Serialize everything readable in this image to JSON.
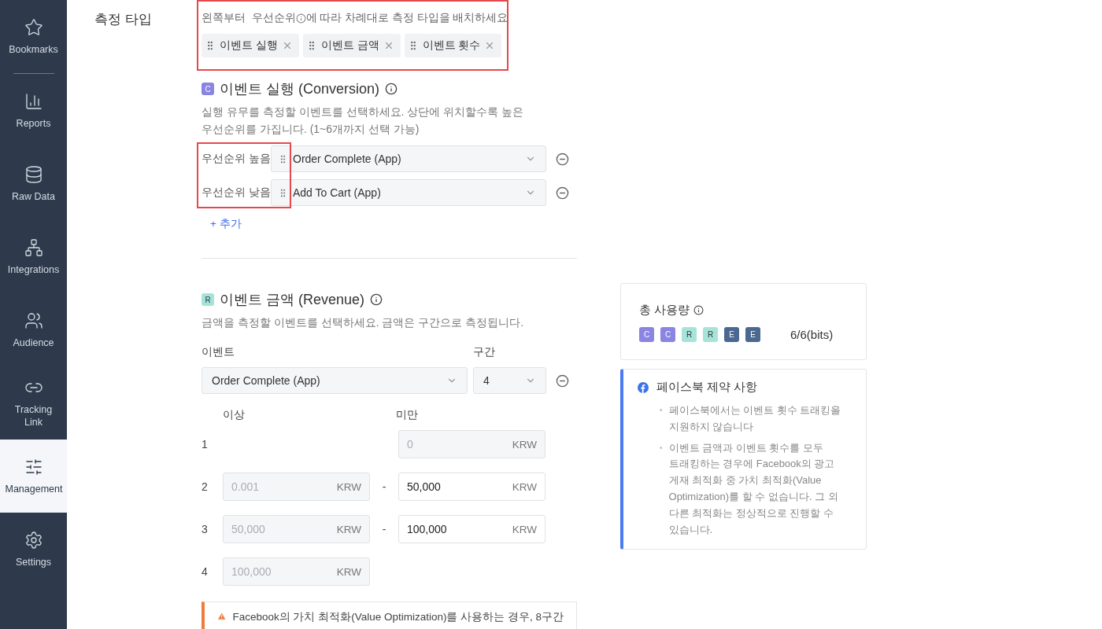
{
  "sidebar": {
    "items": [
      {
        "label": "Bookmarks",
        "selected": false
      },
      {
        "label": "Reports",
        "selected": false
      },
      {
        "label": "Raw Data",
        "selected": false
      },
      {
        "label": "Integrations",
        "selected": false
      },
      {
        "label": "Audience",
        "selected": false
      },
      {
        "label": "Tracking Link",
        "selected": false
      },
      {
        "label": "Management",
        "selected": true
      },
      {
        "label": "Settings",
        "selected": false
      }
    ]
  },
  "section_label": "측정 타입",
  "order": {
    "instruction_before": "왼쪽부터  우선순위",
    "instruction_after": "에 따라 차례대로 측정 타입을 배치하세요",
    "highlighted": true,
    "tags": [
      {
        "label": "이벤트 실행"
      },
      {
        "label": "이벤트 금액"
      },
      {
        "label": "이벤트 횟수"
      }
    ]
  },
  "conversion": {
    "badge": "C",
    "title": "이벤트 실행 (Conversion)",
    "description": "실행 유무를 측정할 이벤트를 선택하세요. 상단에 위치할수록 높은 우선순위를 가집니다. (1~6개까지 선택 가능)",
    "highlighted": true,
    "rows": [
      {
        "priority": "우선순위 높음",
        "value": "Order Complete (App)"
      },
      {
        "priority": "우선순위 낮음",
        "value": "Add To Cart (App)"
      }
    ],
    "add_link": "+ 추가"
  },
  "revenue": {
    "badge": "R",
    "title": "이벤트 금액 (Revenue)",
    "description": "금액을 측정할 이벤트를 선택하세요. 금액은 구간으로 측정됩니다.",
    "event_label": "이벤트",
    "event_value": "Order Complete (App)",
    "interval_label": "구간",
    "interval_value": "4",
    "lower_header": "이상",
    "upper_header": "미만",
    "ranges": [
      {
        "index": "1",
        "upper": {
          "value": "0",
          "unit": "KRW",
          "disabled": true
        }
      },
      {
        "index": "2",
        "lower": {
          "value": "0.001",
          "unit": "KRW",
          "disabled": true
        },
        "separator": "-",
        "upper": {
          "value": "50,000",
          "unit": "KRW",
          "disabled": false
        }
      },
      {
        "index": "3",
        "lower": {
          "value": "50,000",
          "unit": "KRW",
          "disabled": true
        },
        "separator": "-",
        "upper": {
          "value": "100,000",
          "unit": "KRW",
          "disabled": false
        }
      },
      {
        "index": "4",
        "lower": {
          "value": "100,000",
          "unit": "KRW",
          "disabled": true
        }
      }
    ],
    "warning": "Facebook의 가치 최적화(Value Optimization)를 사용하는 경우, 8구간"
  },
  "usage": {
    "title": "총 사용량",
    "bits": [
      {
        "label": "C",
        "color": "#8a84e2"
      },
      {
        "label": "C",
        "color": "#8a84e2"
      },
      {
        "label": "R",
        "color": "#a6e3d9"
      },
      {
        "label": "R",
        "color": "#a6e3d9"
      },
      {
        "label": "E",
        "color": "#4b6890"
      },
      {
        "label": "E",
        "color": "#4b6890"
      }
    ],
    "total": "6/6(bits)"
  },
  "facebook": {
    "title": "페이스북 제약 사항",
    "notes": [
      {
        "marker": "•",
        "text": "페이스북에서는 이벤트 횟수 트래킹을 지원하지 않습니다"
      },
      {
        "marker": "•",
        "text": "이벤트 금액과 이벤트 횟수를 모두 트래킹하는 경우에 Facebook의 광고 게재 최적화 중 가치 최적화(Value Optimization)를 할 수 없습니다. 그 외 다른 최적화는 정상적으로 진행할 수 있습니다."
      }
    ]
  }
}
